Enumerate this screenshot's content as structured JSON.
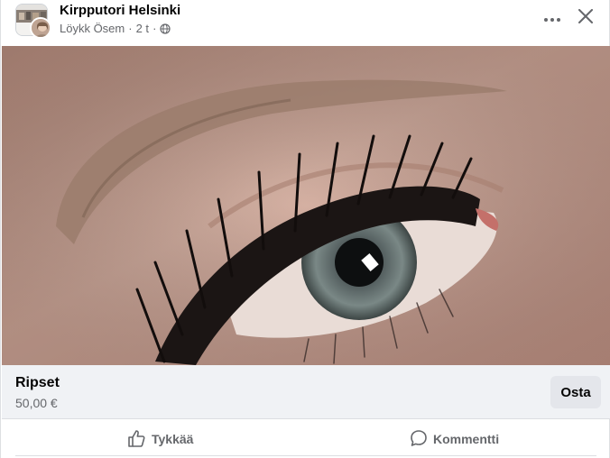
{
  "post": {
    "group_name": "Kirpputori Helsinki",
    "author": "Löykk Ösem",
    "time": "2 t",
    "separator": "·"
  },
  "icons": {
    "more": "more-horizontal-icon",
    "close": "close-x-icon",
    "globe": "globe-icon",
    "like": "thumbs-up-icon",
    "comment": "comment-bubble-icon"
  },
  "photo": {
    "subject": "eyelash-extension-closeup"
  },
  "listing": {
    "title": "Ripset",
    "price": "50,00 €",
    "buy_label": "Osta"
  },
  "actions": {
    "like_label": "Tykkää",
    "comment_label": "Kommentti"
  },
  "colors": {
    "secondary_text": "#65676b",
    "listing_bg": "#f0f2f5",
    "button_bg": "#e4e6eb"
  }
}
